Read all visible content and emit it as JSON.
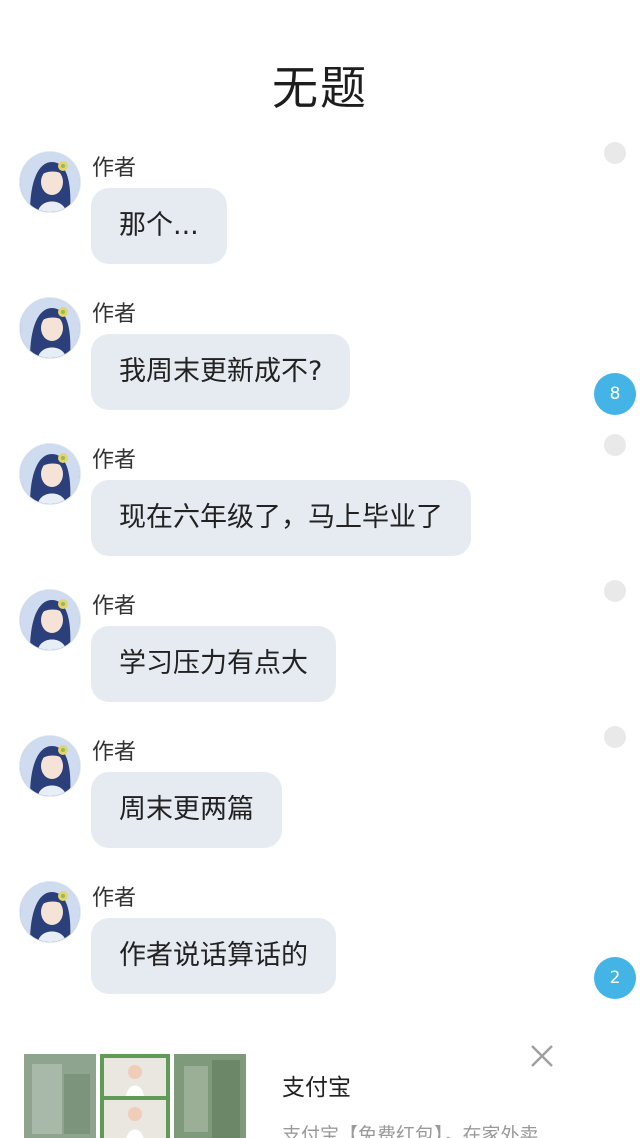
{
  "header": {
    "title": "无题"
  },
  "messages": [
    {
      "sender": "作者",
      "text": "那个..."
    },
    {
      "sender": "作者",
      "text": "我周末更新成不?"
    },
    {
      "sender": "作者",
      "text": "现在六年级了，马上毕业了"
    },
    {
      "sender": "作者",
      "text": "学习压力有点大"
    },
    {
      "sender": "作者",
      "text": "周末更两篇"
    },
    {
      "sender": "作者",
      "text": "作者说话算话的"
    }
  ],
  "badges": {
    "first": "8",
    "second": "2"
  },
  "ad": {
    "title": "支付宝",
    "description": "支付宝【免费红包】，在家外卖"
  },
  "colors": {
    "bubble": "#e6ebf2",
    "badge": "#44b4e6",
    "dot": "#e9e9e9"
  }
}
